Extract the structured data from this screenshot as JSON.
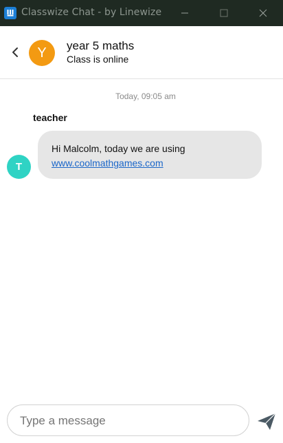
{
  "window": {
    "title": "Classwize Chat - by Linewize",
    "icon": "linewize-app-icon",
    "controls": [
      "minimize-icon",
      "maximize-icon",
      "close-icon"
    ]
  },
  "header": {
    "avatar_initial": "Y",
    "title": "year 5 maths",
    "status": "Class is online",
    "avatar_color": "#f39a12"
  },
  "messages": {
    "timestamp": "Today, 09:05 am",
    "items": [
      {
        "sender": "teacher",
        "avatar_initial": "T",
        "avatar_color": "#2fd3c4",
        "text": "Hi Malcolm, today we are using",
        "link_text": "www.coolmathgames.com"
      }
    ]
  },
  "composer": {
    "placeholder": "Type a message",
    "value": "",
    "send_icon": "send-icon"
  },
  "colors": {
    "titlebar": "#1f2a22",
    "bubble": "#e6e6e6",
    "link": "#1a66c9"
  }
}
